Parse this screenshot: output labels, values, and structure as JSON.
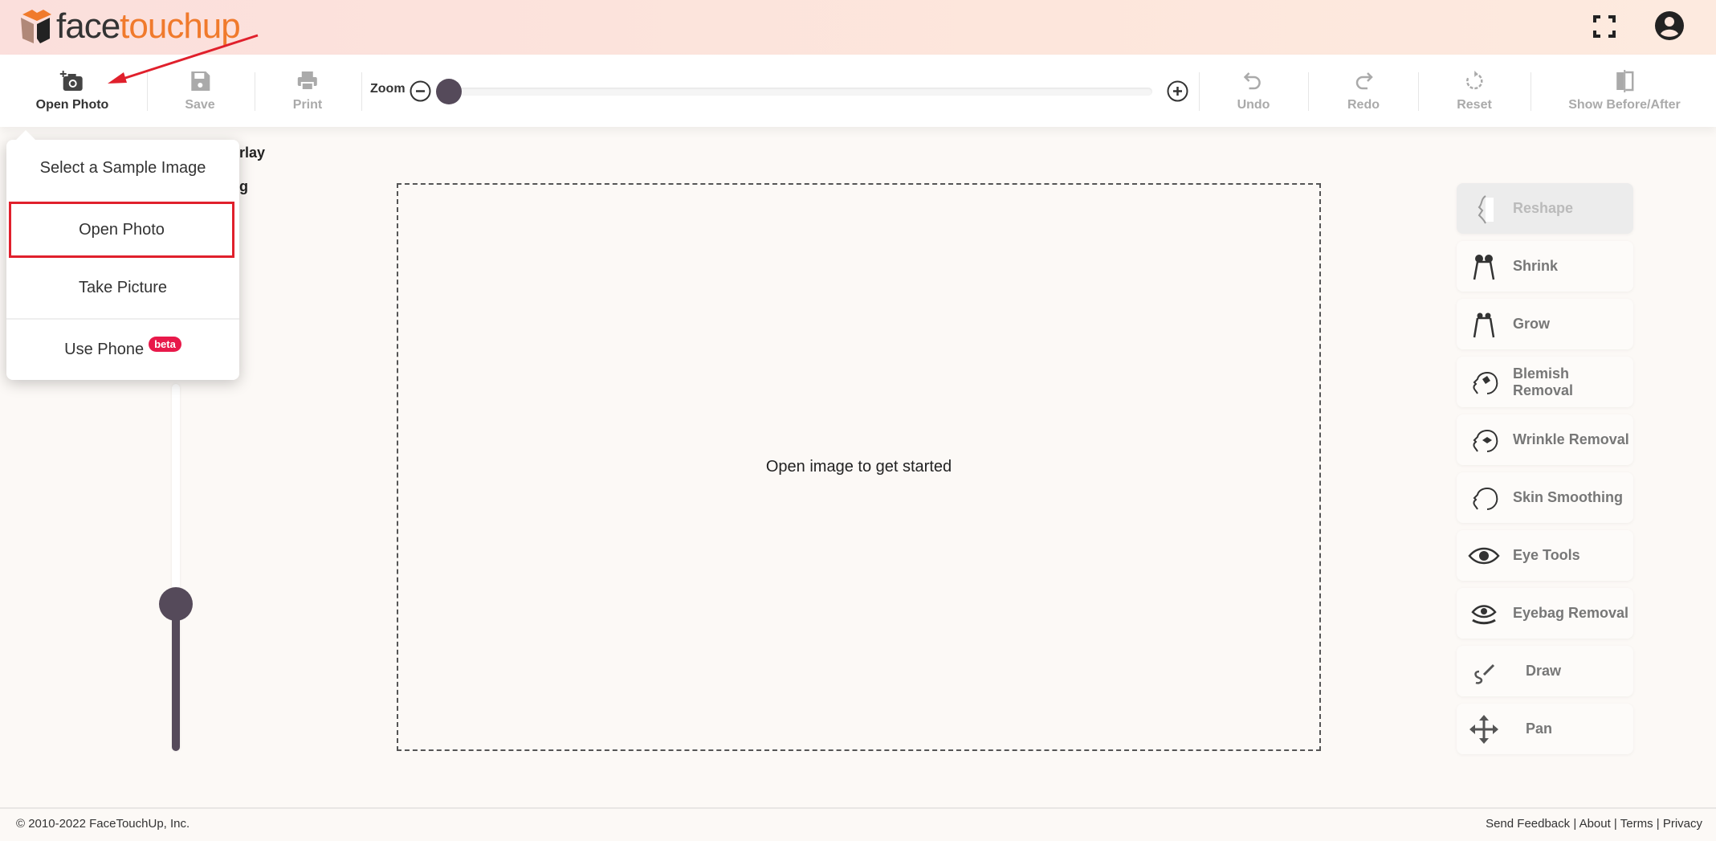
{
  "header": {
    "logo_part1": "face",
    "logo_part2": "touchup",
    "fullscreen_icon": "fullscreen-icon",
    "account_icon": "account-circle-icon"
  },
  "toolbar": {
    "open_photo": "Open Photo",
    "save": "Save",
    "print": "Print",
    "zoom_label": "Zoom",
    "zoom_level": 0,
    "undo": "Undo",
    "redo": "Redo",
    "reset": "Reset",
    "before_after": "Show Before/After"
  },
  "popup": {
    "items": [
      "Select a Sample Image",
      "Open Photo",
      "Take Picture",
      "Use Phone"
    ],
    "badge": "beta",
    "highlighted": "Open Photo"
  },
  "left_panel": {
    "label1_fragment": "rlay",
    "label2_fragment": "g",
    "slider_value_percent": 40
  },
  "canvas": {
    "placeholder": "Open image to get started"
  },
  "tools": [
    {
      "label": "Reshape",
      "icon": "reshape-face-icon",
      "disabled": true
    },
    {
      "label": "Shrink",
      "icon": "shrink-icon"
    },
    {
      "label": "Grow",
      "icon": "grow-icon"
    },
    {
      "label": "Blemish Removal",
      "icon": "blemish-icon"
    },
    {
      "label": "Wrinkle Removal",
      "icon": "wrinkle-icon"
    },
    {
      "label": "Skin Smoothing",
      "icon": "head-icon"
    },
    {
      "label": "Eye Tools",
      "icon": "eye-icon"
    },
    {
      "label": "Eyebag Removal",
      "icon": "eyebag-icon"
    },
    {
      "label": "Draw",
      "icon": "draw-icon"
    },
    {
      "label": "Pan",
      "icon": "pan-arrows-icon"
    }
  ],
  "footer": {
    "copyright": "© 2010-2022 FaceTouchUp, Inc.",
    "links": [
      "Send Feedback",
      "About",
      "Terms",
      "Privacy"
    ]
  },
  "colors": {
    "accent": "#f07a2c",
    "slider": "#554a5a",
    "highlight_box": "#e0202c",
    "badge": "#e8194a"
  }
}
